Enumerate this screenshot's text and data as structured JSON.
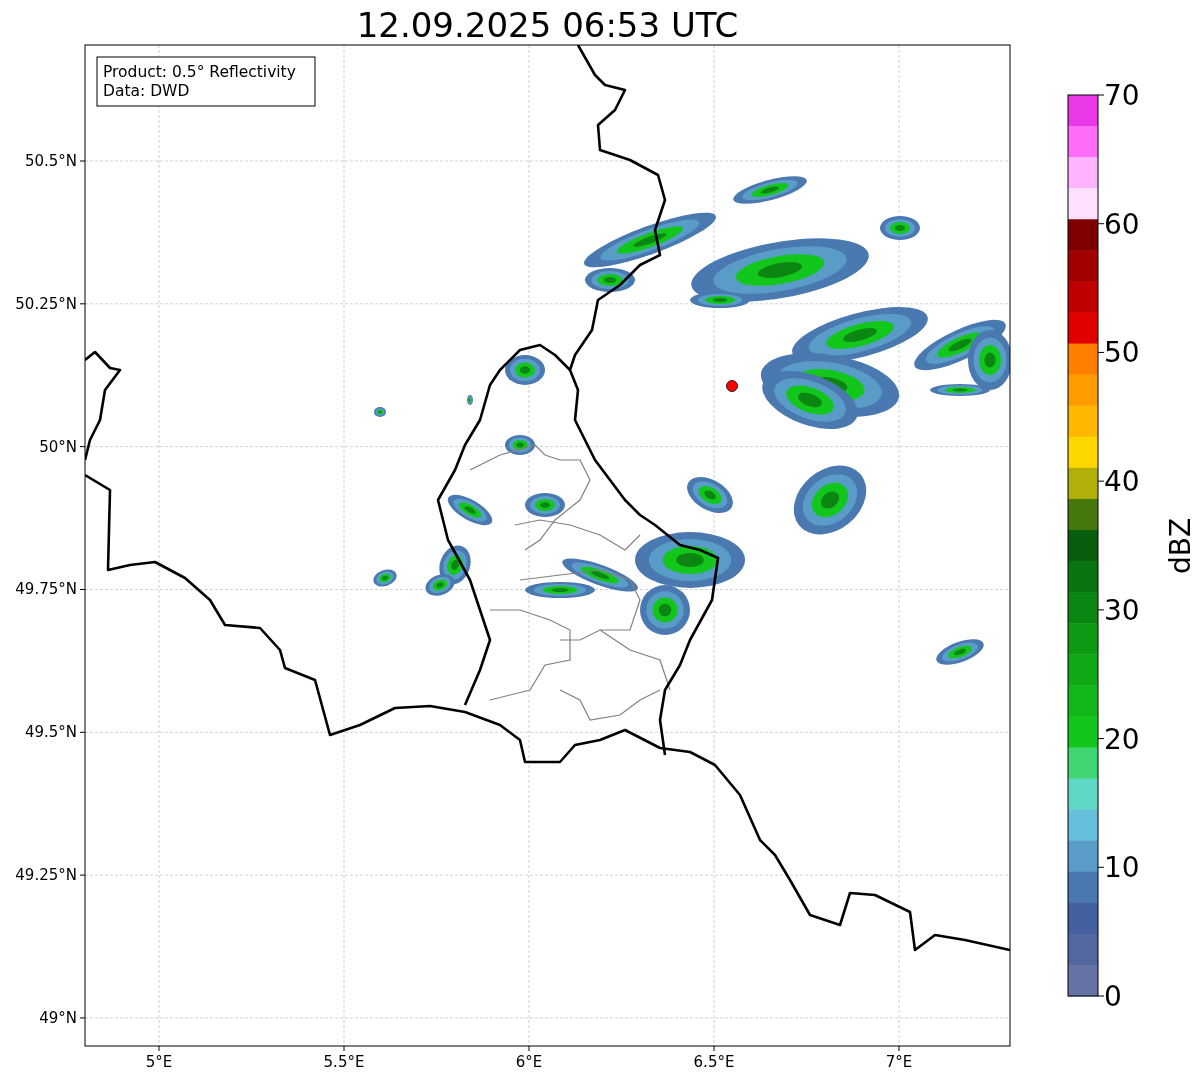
{
  "title": "12.09.2025 06:53 UTC",
  "legend": [
    "Product: 0.5° Reflectivity",
    "Data: DWD"
  ],
  "x_axis": {
    "ticks": [
      "5°E",
      "5.5°E",
      "6°E",
      "6.5°E",
      "7°E"
    ]
  },
  "y_axis": {
    "ticks": [
      "50.5°N",
      "50.25°N",
      "50°N",
      "49.75°N",
      "49.5°N",
      "49.25°N",
      "49°N"
    ]
  },
  "colorbar": {
    "label": "dBZ",
    "ticks": [
      "70",
      "60",
      "50",
      "40",
      "30",
      "20",
      "10",
      "0"
    ],
    "segments": [
      {
        "color": "#e838e8"
      },
      {
        "color": "#ff6cf8"
      },
      {
        "color": "#ffb4ff"
      },
      {
        "color": "#ffe0ff"
      },
      {
        "color": "#7f0000"
      },
      {
        "color": "#a00000"
      },
      {
        "color": "#c00000"
      },
      {
        "color": "#e00000"
      },
      {
        "color": "#ff7f00"
      },
      {
        "color": "#ff9c00"
      },
      {
        "color": "#ffb800"
      },
      {
        "color": "#ffd700"
      },
      {
        "color": "#b0b008"
      },
      {
        "color": "#46780e"
      },
      {
        "color": "#095e0e"
      },
      {
        "color": "#0a7412"
      },
      {
        "color": "#0c8612"
      },
      {
        "color": "#0e9a14"
      },
      {
        "color": "#10a816"
      },
      {
        "color": "#12b81a"
      },
      {
        "color": "#13c61c"
      },
      {
        "color": "#3fd672"
      },
      {
        "color": "#5fd8c4"
      },
      {
        "color": "#66c0dc"
      },
      {
        "color": "#5a9cc8"
      },
      {
        "color": "#4a78b0"
      },
      {
        "color": "#4560a0"
      },
      {
        "color": "#5468a0"
      },
      {
        "color": "#6574a5"
      }
    ]
  }
}
